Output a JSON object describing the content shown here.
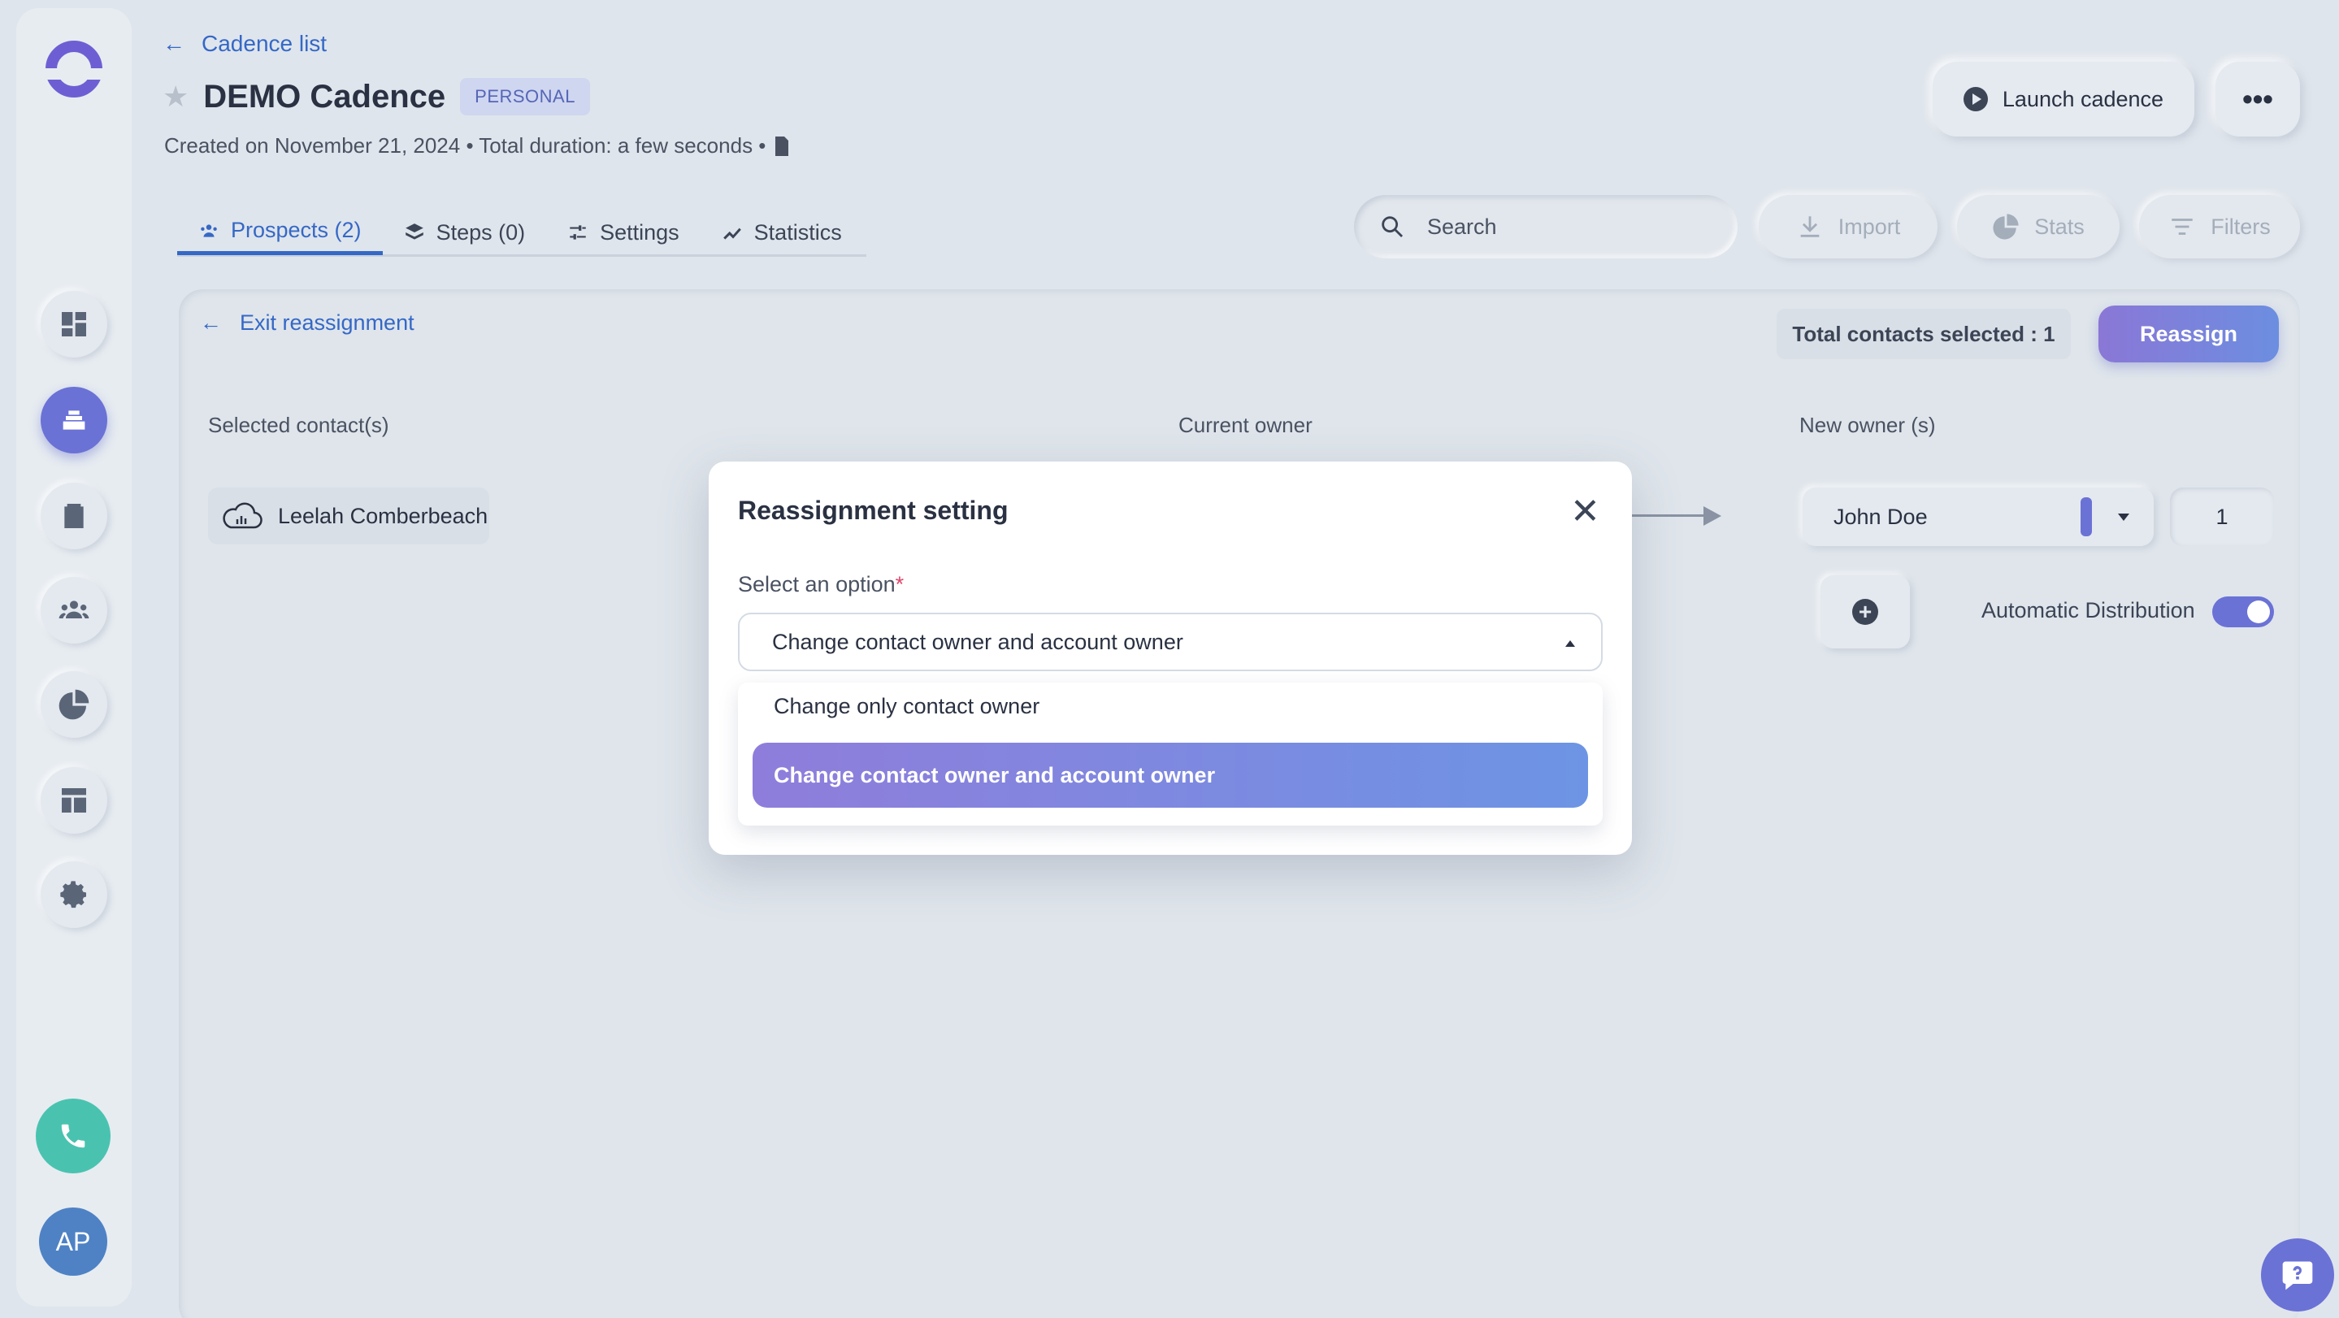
{
  "header": {
    "back_label": "Cadence list",
    "title": "DEMO Cadence",
    "badge": "PERSONAL",
    "meta": "Created on November 21, 2024 • Total duration: a few seconds •"
  },
  "actions": {
    "launch_label": "Launch cadence",
    "more_label": "•••"
  },
  "tabs": [
    {
      "label": "Prospects (2)",
      "icon": "people-icon",
      "active": true
    },
    {
      "label": "Steps (0)",
      "icon": "layers-icon"
    },
    {
      "label": "Settings",
      "icon": "sliders-icon"
    },
    {
      "label": "Statistics",
      "icon": "trend-icon"
    }
  ],
  "toolbar": {
    "search_placeholder": "Search",
    "import_label": "Import",
    "stats_label": "Stats",
    "filters_label": "Filters"
  },
  "reassignment": {
    "exit_label": "Exit reassignment",
    "total_selected": "Total contacts selected : 1",
    "reassign_label": "Reassign",
    "col_selected": "Selected contact(s)",
    "col_current": "Current owner",
    "col_new": "New owner (s)",
    "contact_name": "Leelah Comberbeach",
    "new_owner": "John Doe",
    "owner_quantity": "1",
    "auto_distribution_label": "Automatic Distribution",
    "auto_distribution_on": true
  },
  "modal": {
    "title": "Reassignment setting",
    "close_label": "✕",
    "field_label": "Select an option",
    "required_mark": "*",
    "selected_value": "Change contact owner and account owner",
    "options": [
      "Change only contact owner",
      "Change contact owner and account owner"
    ]
  },
  "sidebar": {
    "avatar_initials": "AP",
    "icons": [
      "dashboard-icon",
      "cadence-icon",
      "clipboard-icon",
      "team-icon",
      "pie-chart-icon",
      "template-icon",
      "gear-icon",
      "phone-icon"
    ]
  },
  "colors": {
    "accent": "#6a72d6",
    "link": "#3568c6",
    "phone": "#49c3b0"
  }
}
